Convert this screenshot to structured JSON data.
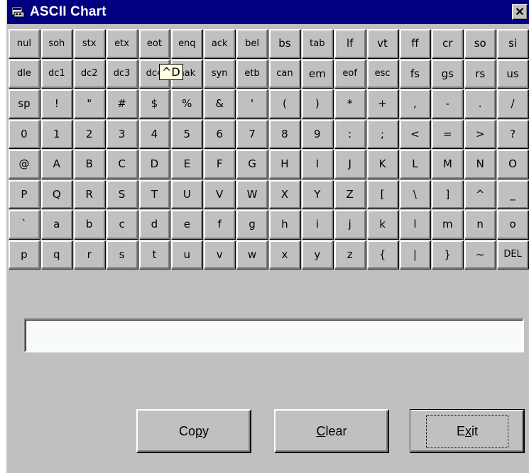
{
  "window": {
    "title": "ASCII Chart",
    "close_label": "✕",
    "colors": {
      "titlebar": "#000080",
      "face": "#c0c0c0"
    }
  },
  "keys": [
    "nul",
    "soh",
    "stx",
    "etx",
    "eot",
    "enq",
    "ack",
    "bel",
    "bs",
    "tab",
    "lf",
    "vt",
    "ff",
    "cr",
    "so",
    "si",
    "dle",
    "dc1",
    "dc2",
    "dc3",
    "dc4",
    "nak",
    "syn",
    "etb",
    "can",
    "em",
    "eof",
    "esc",
    "fs",
    "gs",
    "rs",
    "us",
    "sp",
    "!",
    "\"",
    "#",
    "$",
    "%",
    "&",
    "'",
    "(",
    ")",
    "*",
    "+",
    ",",
    "-",
    ".",
    "/",
    "0",
    "1",
    "2",
    "3",
    "4",
    "5",
    "6",
    "7",
    "8",
    "9",
    ":",
    ";",
    "<",
    "=",
    ">",
    "?",
    "@",
    "A",
    "B",
    "C",
    "D",
    "E",
    "F",
    "G",
    "H",
    "I",
    "J",
    "K",
    "L",
    "M",
    "N",
    "O",
    "P",
    "Q",
    "R",
    "S",
    "T",
    "U",
    "V",
    "W",
    "X",
    "Y",
    "Z",
    "[",
    "\\",
    "]",
    "^",
    "_",
    "`",
    "a",
    "b",
    "c",
    "d",
    "e",
    "f",
    "g",
    "h",
    "i",
    "j",
    "k",
    "l",
    "m",
    "n",
    "o",
    "p",
    "q",
    "r",
    "s",
    "t",
    "u",
    "v",
    "w",
    "x",
    "y",
    "z",
    "{",
    "|",
    "}",
    "~",
    "DEL"
  ],
  "tooltip": "^D",
  "output": {
    "value": ""
  },
  "buttons": {
    "copy": {
      "pre": "Co",
      "ul": "p",
      "post": "y"
    },
    "clear": {
      "pre": "",
      "ul": "C",
      "post": "lear"
    },
    "exit": {
      "pre": "E",
      "ul": "x",
      "post": "it"
    }
  }
}
